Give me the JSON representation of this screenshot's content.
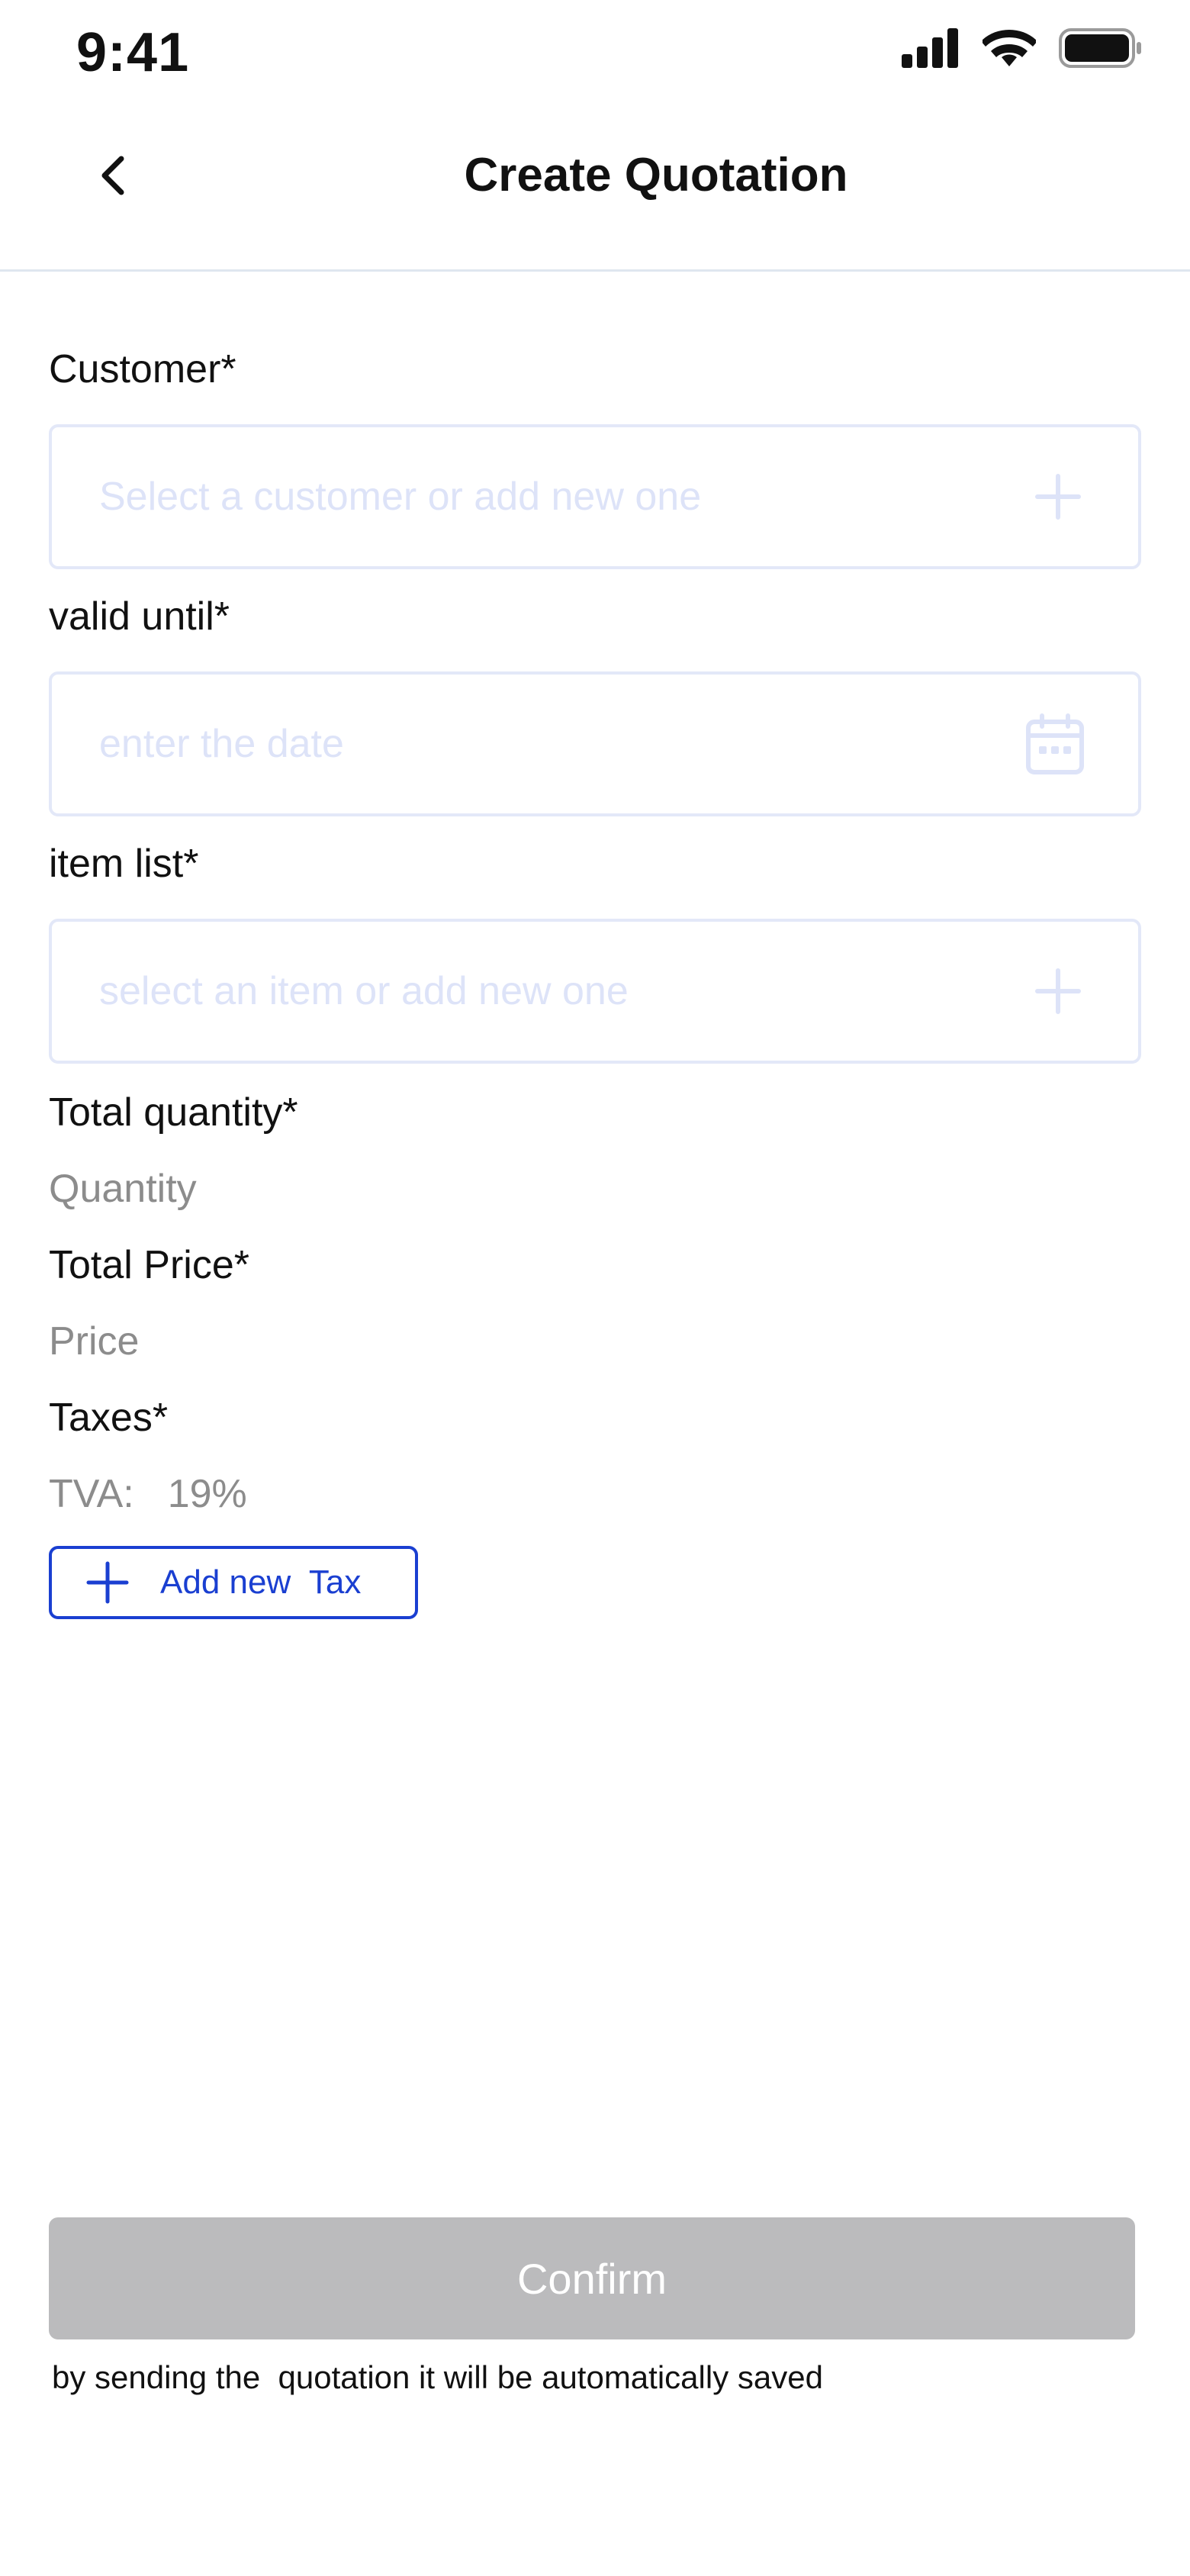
{
  "status_bar": {
    "time": "9:41",
    "icons": [
      "signal-icon",
      "wifi-icon",
      "battery-icon"
    ]
  },
  "header": {
    "title": "Create Quotation",
    "back_icon": "chevron-left-icon"
  },
  "form": {
    "customer": {
      "label": "Customer*",
      "placeholder": "Select a customer or add new one",
      "icon": "plus-icon"
    },
    "valid_until": {
      "label": "valid until*",
      "placeholder": "enter the date",
      "icon": "calendar-icon"
    },
    "item_list": {
      "label": "item list*",
      "placeholder": "select an item or add new one",
      "icon": "plus-icon"
    },
    "total_quantity": {
      "label": "Total quantity*",
      "value": "Quantity"
    },
    "total_price": {
      "label": "Total Price*",
      "value": "Price"
    },
    "taxes": {
      "label": "Taxes*",
      "tax_name": "TVA:",
      "tax_value": "19%",
      "add_button_label": "Add new  Tax"
    }
  },
  "footer": {
    "confirm_label": "Confirm",
    "note": "by sending the  quotation it will be automatically saved"
  },
  "colors": {
    "accent": "#1a3fd1",
    "input_border": "#e3e8f8",
    "placeholder": "#dde3f8",
    "confirm_disabled": "#bbbbbd",
    "muted_text": "#8c8c8c"
  }
}
